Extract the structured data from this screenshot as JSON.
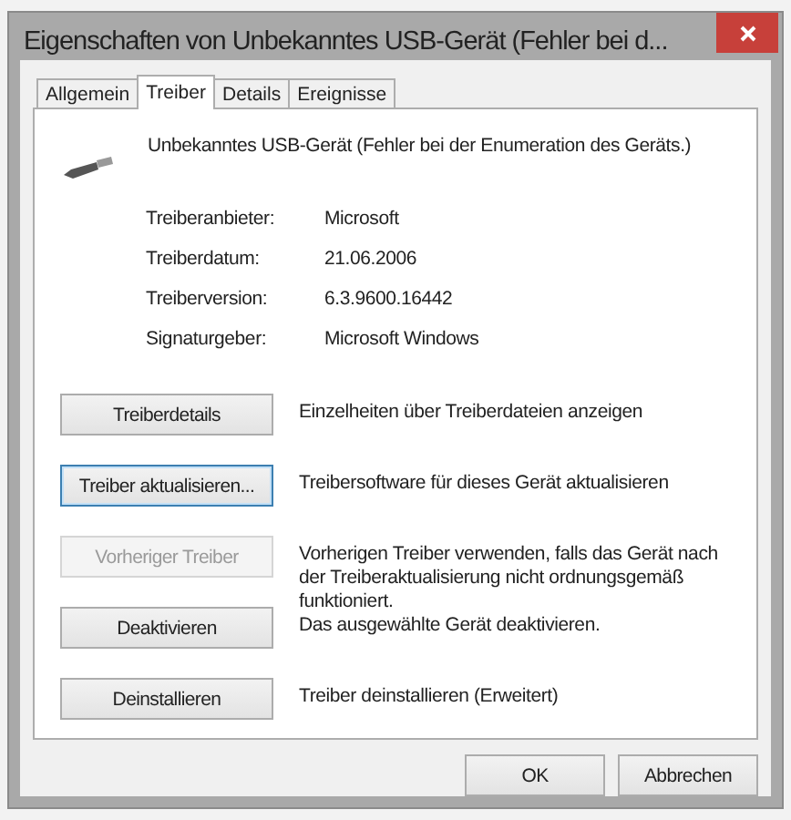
{
  "window": {
    "title": "Eigenschaften von Unbekanntes USB-Gerät (Fehler bei d..."
  },
  "tabs": [
    {
      "label": "Allgemein",
      "selected": false
    },
    {
      "label": "Treiber",
      "selected": true
    },
    {
      "label": "Details",
      "selected": false
    },
    {
      "label": "Ereignisse",
      "selected": false
    }
  ],
  "device": {
    "name": "Unbekanntes USB-Gerät (Fehler bei der Enumeration des Geräts.)"
  },
  "properties": [
    {
      "label": "Treiberanbieter:",
      "value": "Microsoft"
    },
    {
      "label": "Treiberdatum:",
      "value": "21.06.2006"
    },
    {
      "label": "Treiberversion:",
      "value": "6.3.9600.16442"
    },
    {
      "label": "Signaturgeber:",
      "value": "Microsoft Windows"
    }
  ],
  "actions": [
    {
      "button": "Treiberdetails",
      "description": "Einzelheiten über Treiberdateien anzeigen",
      "disabled": false,
      "focused": false
    },
    {
      "button": "Treiber aktualisieren...",
      "description": "Treibersoftware für dieses Gerät aktualisieren",
      "disabled": false,
      "focused": true
    },
    {
      "button": "Vorheriger Treiber",
      "description": "Vorherigen Treiber verwenden, falls das Gerät nach der Treiberaktualisierung nicht ordnungsgemäß funktioniert.",
      "disabled": true,
      "focused": false
    },
    {
      "button": "Deaktivieren",
      "description": "Das ausgewählte Gerät deaktivieren.",
      "disabled": false,
      "focused": false
    },
    {
      "button": "Deinstallieren",
      "description": "Treiber deinstallieren (Erweitert)",
      "disabled": false,
      "focused": false
    }
  ],
  "footer_buttons": [
    "OK",
    "Abbrechen"
  ]
}
